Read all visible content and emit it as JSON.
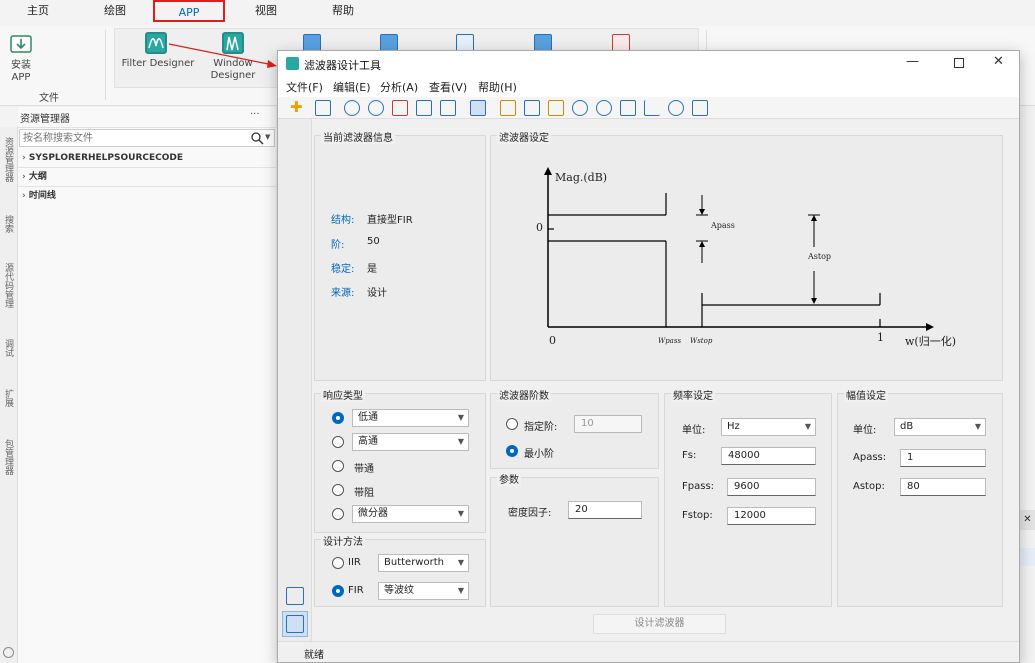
{
  "ribbon": {
    "tabs": [
      "主页",
      "绘图",
      "APP",
      "视图",
      "帮助"
    ],
    "active_tab": "APP",
    "install_label": "安装\nAPP",
    "install_line1": "安装",
    "install_line2": "APP",
    "group_label": "文件",
    "apps": [
      "Filter Designer",
      "Window Designer"
    ],
    "app_window_line1": "Window",
    "app_window_line2": "Designer"
  },
  "resource_manager": {
    "title": "资源管理器",
    "more": "···",
    "search_placeholder": "按名称搜索文件",
    "items": [
      "SYSPLORERHELPSOURCECODE",
      "大纲",
      "时间线"
    ]
  },
  "side_tabs": [
    "资源管理器",
    "搜索",
    "源代码管理",
    "调试",
    "扩展",
    "包管理器"
  ],
  "dialog": {
    "title": "滤波器设计工具",
    "menus": [
      "文件(F)",
      "编辑(E)",
      "分析(A)",
      "查看(V)",
      "帮助(H)"
    ],
    "info": {
      "title": "当前滤波器信息",
      "rows": [
        {
          "label": "结构:",
          "value": "直接型FIR"
        },
        {
          "label": "阶:",
          "value": "50"
        },
        {
          "label": "稳定:",
          "value": "是"
        },
        {
          "label": "来源:",
          "value": "设计"
        }
      ]
    },
    "spec": {
      "title": "滤波器设定",
      "y_axis": "Mag.(dB)",
      "zero_y": "0",
      "origin": "0",
      "apass": "Apass",
      "astop": "Astop",
      "wpass": "Wpass",
      "wstop": "Wstop",
      "one": "1",
      "x_axis": "w(归一化)"
    },
    "response": {
      "title": "响应类型",
      "options": [
        "低通",
        "高通",
        "带通",
        "带阻",
        "微分器"
      ],
      "selected": "低通"
    },
    "method": {
      "title": "设计方法",
      "iir_label": "IIR",
      "iir_value": "Butterworth",
      "fir_label": "FIR",
      "fir_value": "等波纹",
      "selected": "FIR"
    },
    "order": {
      "title": "滤波器阶数",
      "specify_label": "指定阶:",
      "specify_value": "10",
      "min_label": "最小阶",
      "selected": "最小阶"
    },
    "params": {
      "title": "参数",
      "density_label": "密度因子:",
      "density_value": "20"
    },
    "freq": {
      "title": "频率设定",
      "unit_label": "单位:",
      "unit_value": "Hz",
      "fs_label": "Fs:",
      "fs_value": "48000",
      "fpass_label": "Fpass:",
      "fpass_value": "9600",
      "fstop_label": "Fstop:",
      "fstop_value": "12000"
    },
    "mag": {
      "title": "幅值设定",
      "unit_label": "单位:",
      "unit_value": "dB",
      "apass_label": "Apass:",
      "apass_value": "1",
      "astop_label": "Astop:",
      "astop_value": "80"
    },
    "design_button": "设计滤波器",
    "status": "就绪"
  },
  "colors": {
    "accent": "#0067c0",
    "highlight_box": "#e11d1d",
    "arrow": "#e11d1d"
  }
}
